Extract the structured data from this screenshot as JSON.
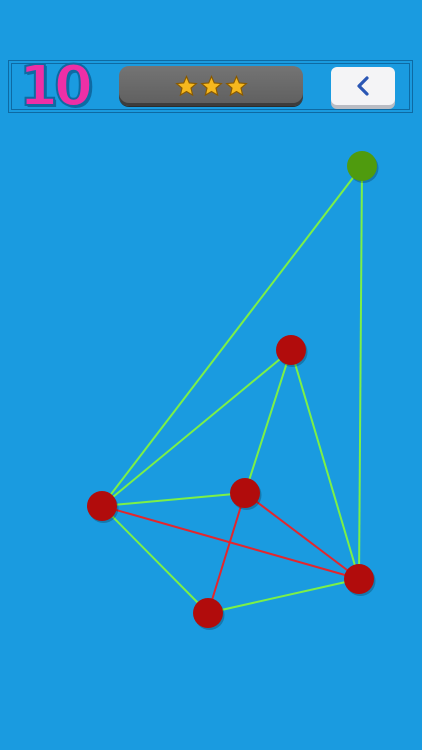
{
  "header": {
    "level_number": "10",
    "stars_earned": 3,
    "stars_total": 3,
    "back_icon": "chevron-left-icon"
  },
  "colors": {
    "background": "#1a9be0",
    "level_number": "#ee2fa6",
    "star": "#f6b81e",
    "panel": "#6b6b6b",
    "back_button": "#f4f4f6",
    "back_chevron": "#2a56b4",
    "line_free": "#7cf047",
    "line_crossing": "#e3262d",
    "node_selected": "#4f9b0e",
    "node_normal": "#b10c0c"
  },
  "puzzle": {
    "nodes": [
      {
        "id": "n0",
        "state": "selected"
      },
      {
        "id": "n1",
        "state": "normal"
      },
      {
        "id": "n2",
        "state": "normal"
      },
      {
        "id": "n3",
        "state": "normal"
      },
      {
        "id": "n4",
        "state": "normal"
      },
      {
        "id": "n5",
        "state": "normal"
      }
    ],
    "edges": [
      {
        "from": "n0",
        "to": "n3",
        "state": "free"
      },
      {
        "from": "n0",
        "to": "n4",
        "state": "free"
      },
      {
        "from": "n1",
        "to": "n3",
        "state": "free"
      },
      {
        "from": "n1",
        "to": "n2",
        "state": "free"
      },
      {
        "from": "n1",
        "to": "n4",
        "state": "free"
      },
      {
        "from": "n3",
        "to": "n2",
        "state": "free"
      },
      {
        "from": "n3",
        "to": "n5",
        "state": "free"
      },
      {
        "from": "n5",
        "to": "n4",
        "state": "free"
      },
      {
        "from": "n3",
        "to": "n4",
        "state": "crossing"
      },
      {
        "from": "n2",
        "to": "n4",
        "state": "crossing"
      },
      {
        "from": "n2",
        "to": "n5",
        "state": "crossing"
      }
    ]
  }
}
